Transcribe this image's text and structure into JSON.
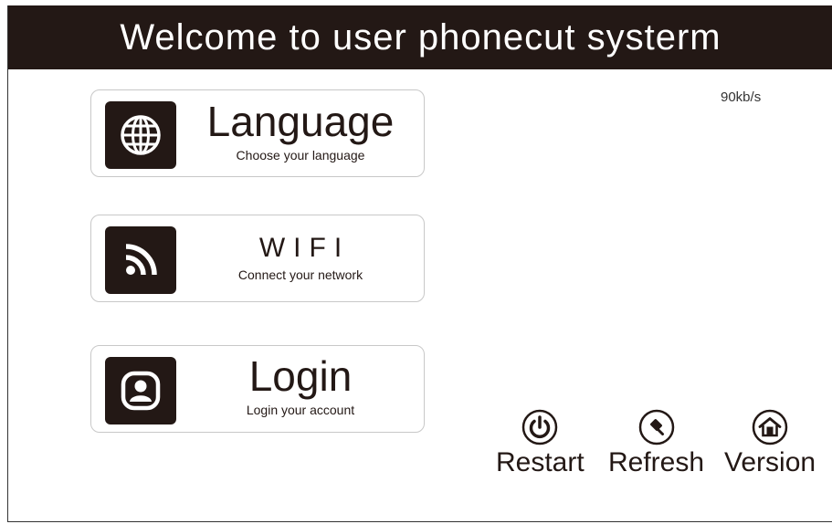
{
  "header": {
    "title": "Welcome to user phonecut systerm"
  },
  "status": {
    "network_speed": "90kb/s"
  },
  "menu": [
    {
      "key": "language",
      "title": "Language",
      "subtitle": "Choose your language",
      "icon": "globe-icon"
    },
    {
      "key": "wifi",
      "title": "WIFI",
      "subtitle": "Connect your network",
      "icon": "wifi-icon"
    },
    {
      "key": "login",
      "title": "Login",
      "subtitle": "Login your account",
      "icon": "user-icon"
    }
  ],
  "actions": {
    "restart": {
      "label": "Restart",
      "icon": "power-icon"
    },
    "refresh": {
      "label": "Refresh",
      "icon": "eraser-icon"
    },
    "version": {
      "label": "Version",
      "icon": "home-icon"
    }
  },
  "colors": {
    "header_bg": "#231815",
    "header_text": "#ffffff",
    "icon_tile": "#231815",
    "card_border": "#c8c8c8"
  }
}
